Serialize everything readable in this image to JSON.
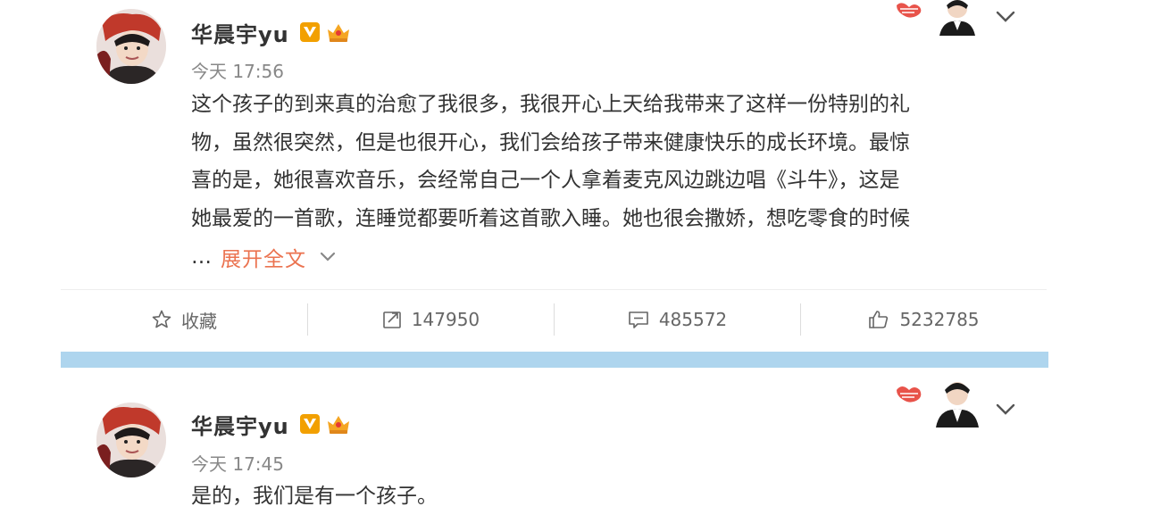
{
  "posts": [
    {
      "username": "华晨宇yu",
      "time": "今天 17:56",
      "content_lines": [
        "这个孩子的到来真的治愈了我很多，我很开心上天给我带来了这样一份特别的礼",
        "物，虽然很突然，但是也很开心，我们会给孩子带来健康快乐的成长环境。最惊",
        "喜的是，她很喜欢音乐，会经常自己一个人拿着麦克风边跳边唱《斗牛》，这是",
        "她最爱的一首歌，连睡觉都要听着这首歌入睡。她也很会撒娇，想吃零食的时候"
      ],
      "ellipsis": "…",
      "expand_label": "展开全文",
      "actions": {
        "favorite_label": "收藏",
        "repost_count": "147950",
        "comment_count": "485572",
        "like_count": "5232785"
      }
    },
    {
      "username": "华晨宇yu",
      "time": "今天 17:45",
      "content_lines": [
        "是的，我们是有一个孩子。"
      ]
    }
  ],
  "colors": {
    "accent_link": "#eb7350",
    "verified_badge": "#f2a000",
    "separator_band": "#aed5ee"
  },
  "icons": [
    "star-icon",
    "repost-icon",
    "comment-icon",
    "thumbs-up-icon",
    "chevron-down-icon",
    "verified-v-icon",
    "crown-badge-icon"
  ]
}
